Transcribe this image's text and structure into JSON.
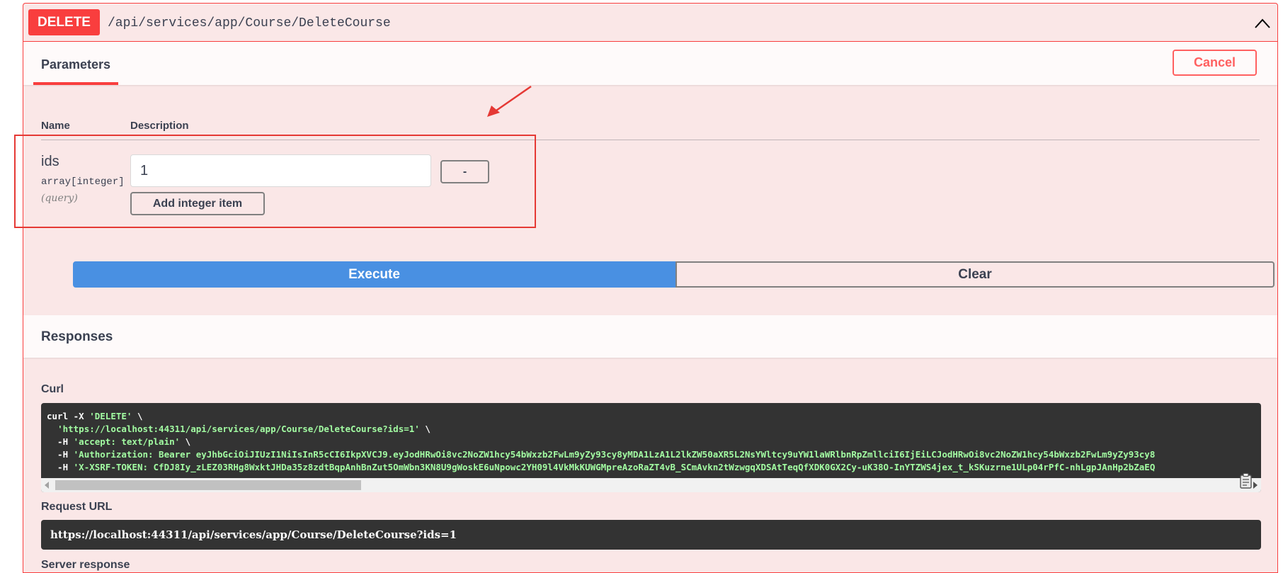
{
  "operation": {
    "method": "DELETE",
    "path": "/api/services/app/Course/DeleteCourse"
  },
  "params_section": {
    "tab_label": "Parameters",
    "cancel_label": "Cancel",
    "column_name": "Name",
    "column_description": "Description",
    "parameter": {
      "name": "ids",
      "type": "array[integer]",
      "location": "(query)",
      "value": "1",
      "remove_label": "-",
      "add_label": "Add integer item"
    }
  },
  "actions": {
    "execute_label": "Execute",
    "clear_label": "Clear"
  },
  "responses": {
    "title": "Responses",
    "curl_label": "Curl",
    "curl_lines": [
      {
        "prefix": "curl -X ",
        "string": "'DELETE'",
        "suffix": " \\"
      },
      {
        "prefix": "  ",
        "string": "'https://localhost:44311/api/services/app/Course/DeleteCourse?ids=1'",
        "suffix": " \\"
      },
      {
        "prefix": "  -H ",
        "string": "'accept: text/plain'",
        "suffix": " \\"
      },
      {
        "prefix": "  -H ",
        "string": "'Authorization: Bearer eyJhbGciOiJIUzI1NiIsInR5cCI6IkpXVCJ9.eyJodHRwOi8vc2NoZW1hcy54bWxzb2FwLm9yZy93cy8yMDA1LzA1L2lkZW50aXR5L2NsYWltcy9uYW1laWRlbnRpZmllciI6IjEiLCJodHRwOi8vc2NoZW1hcy54bWxzb2FwLm9yZy93cy8",
        "suffix": ""
      },
      {
        "prefix": "  -H ",
        "string": "'X-XSRF-TOKEN: CfDJ8Iy_zLEZ03RHg8WxktJHDa35z8zdtBqpAnhBnZut5OmWbn3KN8U9gWoskE6uNpowc2YH09l4VkMkKUWGMpreAzoRaZT4vB_SCmAvkn2tWzwgqXDSAtTeqQfXDK0GX2Cy-uK38O-InYTZWS4jex_t_kSKuzrne1ULp04rPfC-nhLgpJAnHp2bZaEQ",
        "suffix": ""
      }
    ],
    "request_url_label": "Request URL",
    "request_url": "https://localhost:44311/api/services/app/Course/DeleteCourse?ids=1",
    "server_response_label": "Server response"
  },
  "colors": {
    "delete_accent": "#f93e3e",
    "block_background": "#fae7e7",
    "execute_blue": "#4990e2",
    "annotation_red": "#e53935"
  },
  "icons": {
    "collapse": "chevron-up-icon",
    "copy": "clipboard-icon",
    "annotation": "arrow-annotation"
  }
}
